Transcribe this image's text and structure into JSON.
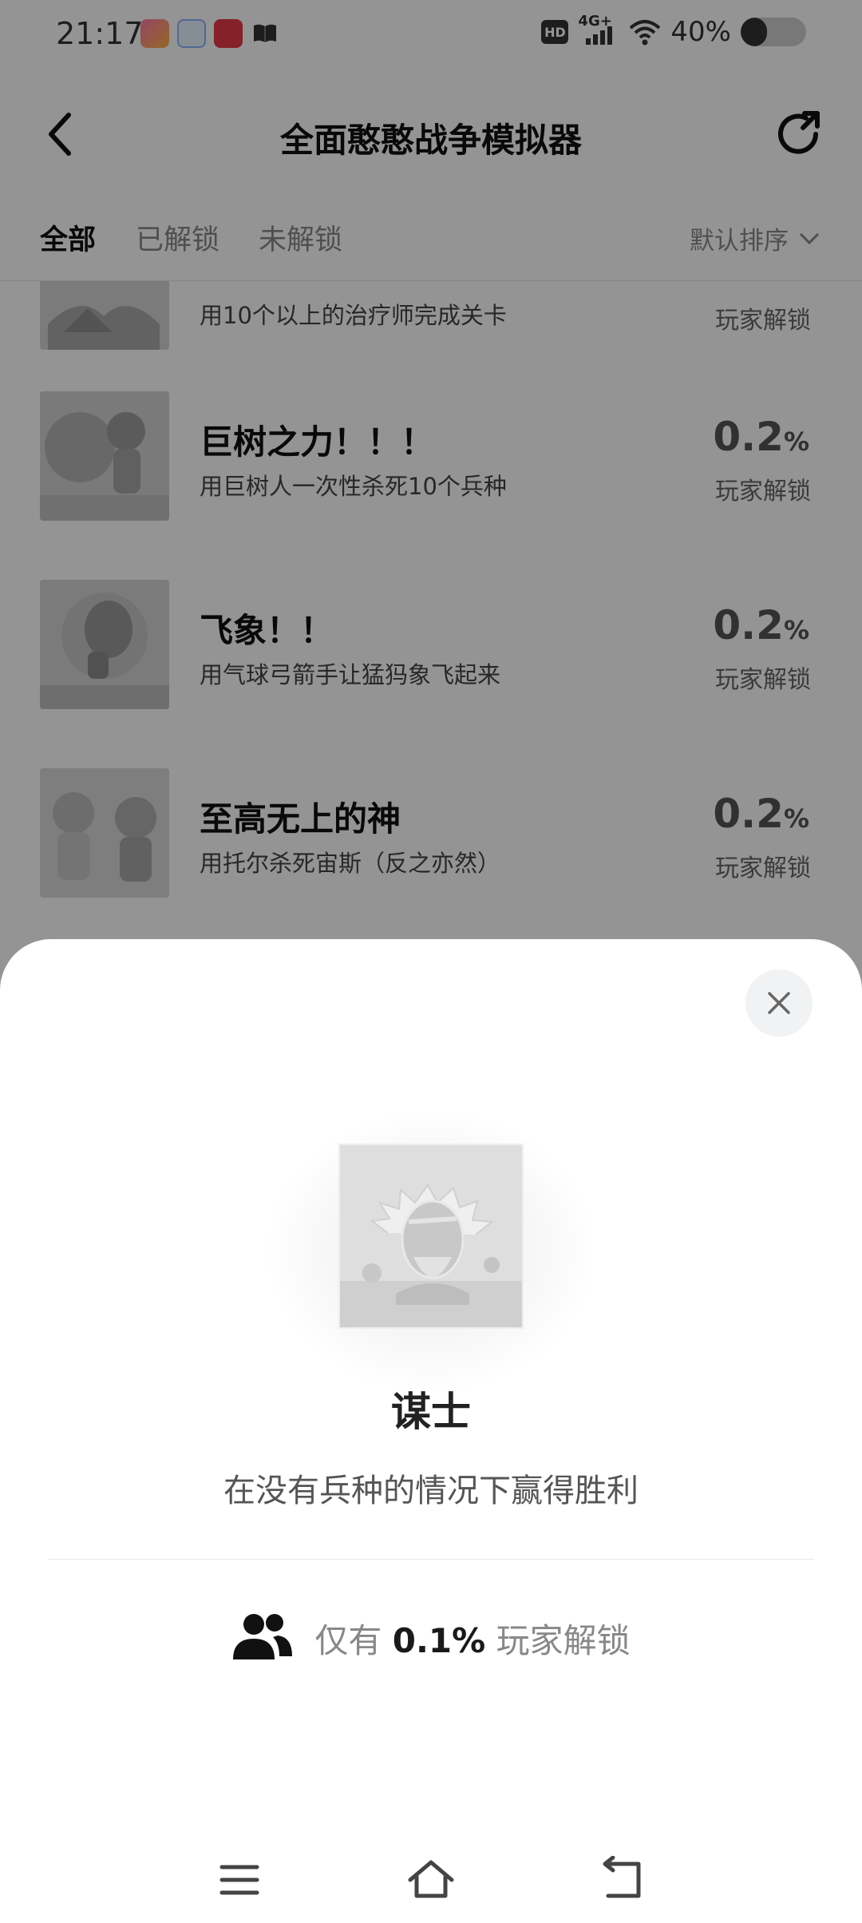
{
  "status_bar": {
    "time": "21:17",
    "app_icons": [
      "rainbow-app-icon",
      "100-app-icon",
      "red-heart-app-icon",
      "book-icon"
    ],
    "hd": "HD",
    "network": "4G+",
    "battery_percent": "40%",
    "battery_level": 0.4
  },
  "header": {
    "title": "全面憨憨战争模拟器"
  },
  "tabs": [
    {
      "label": "全部",
      "active": true
    },
    {
      "label": "已解锁",
      "active": false
    },
    {
      "label": "未解锁",
      "active": false
    }
  ],
  "sort": {
    "label": "默认排序"
  },
  "achievements": [
    {
      "title": "",
      "desc": "用10个以上的治疗师完成关卡",
      "percent": "",
      "unit": "",
      "sub": "玩家解锁"
    },
    {
      "title": "巨树之力！！！",
      "desc": "用巨树人一次性杀死10个兵种",
      "percent": "0.2",
      "unit": "%",
      "sub": "玩家解锁"
    },
    {
      "title": "飞象！！",
      "desc": "用气球弓箭手让猛犸象飞起来",
      "percent": "0.2",
      "unit": "%",
      "sub": "玩家解锁"
    },
    {
      "title": "至高无上的神",
      "desc": "用托尔杀死宙斯（反之亦然）",
      "percent": "0.2",
      "unit": "%",
      "sub": "玩家解锁"
    }
  ],
  "sheet": {
    "name": "谋士",
    "description": "在没有兵种的情况下赢得胜利",
    "stat_prefix": "仅有",
    "stat_value": "0.1%",
    "stat_suffix": "玩家解锁"
  },
  "colors": {
    "overlay": "rgba(0,0,0,0.42)",
    "text_primary": "#222222",
    "text_secondary": "#888888"
  }
}
